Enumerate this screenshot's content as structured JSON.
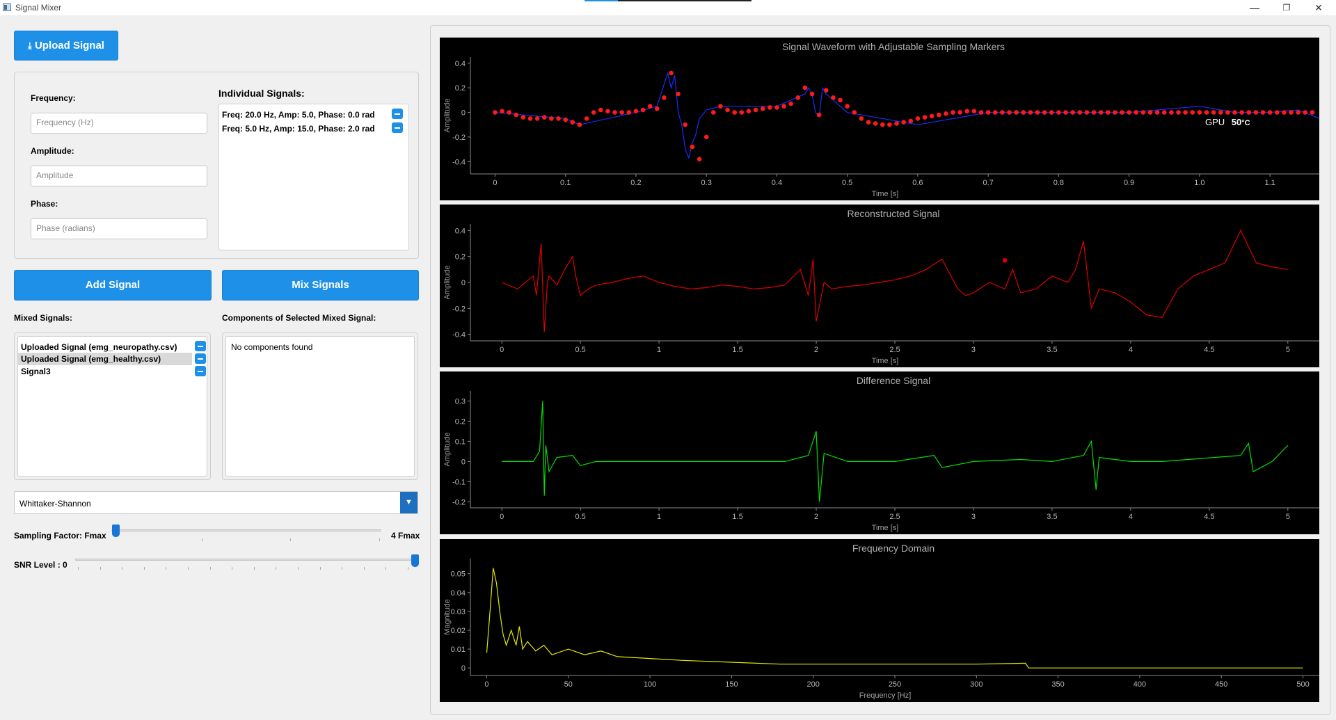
{
  "window": {
    "title": "Signal Mixer",
    "icons": [
      "minimize-icon",
      "restore-icon",
      "close-icon"
    ],
    "accent": "#1e90e8"
  },
  "upload": {
    "label": "Upload Signal",
    "icon": "upload-icon"
  },
  "form": {
    "frequency_label": "Frequency:",
    "frequency_placeholder": "Frequency (Hz)",
    "amplitude_label": "Amplitude:",
    "amplitude_placeholder": "Amplitude",
    "phase_label": "Phase:",
    "phase_placeholder": "Phase (radians)"
  },
  "individual": {
    "title": "Individual Signals:",
    "items": [
      "Freq: 20.0 Hz, Amp: 5.0, Phase: 0.0 rad",
      "Freq: 5.0 Hz, Amp: 15.0, Phase: 2.0 rad"
    ]
  },
  "buttons": {
    "add": "Add Signal",
    "mix": "Mix Signals"
  },
  "mixed": {
    "title": "Mixed Signals:",
    "items": [
      "Uploaded Signal (emg_neuropathy.csv)",
      "Uploaded Signal (emg_healthy.csv)",
      "Signal3"
    ],
    "selected_index": 1
  },
  "components": {
    "title": "Components of Selected Mixed Signal:",
    "empty_text": "No components found"
  },
  "reconstruction": {
    "method": "Whittaker-Shannon"
  },
  "sampling": {
    "label": "Sampling Factor: Fmax",
    "max_label": "4 Fmax",
    "level": 0
  },
  "snr": {
    "label": "SNR Level : 0",
    "level": 1
  },
  "gpu": {
    "label": "GPU",
    "value": "50",
    "unit": "°C"
  },
  "chart_data": [
    {
      "type": "scatter",
      "title": "Signal Waveform with Adjustable Sampling Markers",
      "xlabel": "Time [s]",
      "ylabel": "Amplitude",
      "xlim": [
        -0.035,
        1.17
      ],
      "ylim": [
        -0.5,
        0.45
      ],
      "xticks": [
        0,
        0.1,
        0.2,
        0.3,
        0.4,
        0.5,
        0.6,
        0.7,
        0.8,
        0.9,
        1.0,
        1.1
      ],
      "yticks": [
        -0.4,
        -0.2,
        0,
        0.2,
        0.4
      ],
      "xtick_labels": [
        "0",
        "0.1",
        "0.2",
        "0.3",
        "0.4",
        "0.5",
        "0.6",
        "0.7",
        "0.8",
        "0.9",
        "1.0",
        "1.1"
      ],
      "ytick_labels": [
        "-0.4",
        "-0.2",
        "0",
        "0.2",
        "0.4"
      ],
      "series": [
        {
          "kind": "line",
          "color": "#1a2cff",
          "x": [
            0,
            0.1,
            0.12,
            0.2,
            0.23,
            0.245,
            0.25,
            0.255,
            0.26,
            0.265,
            0.27,
            0.275,
            0.28,
            0.285,
            0.29,
            0.3,
            0.32,
            0.4,
            0.44,
            0.445,
            0.45,
            0.455,
            0.46,
            0.465,
            0.47,
            0.48,
            0.5,
            0.6,
            0.7,
            0.8,
            0.9,
            1.0,
            1.05,
            1.1,
            1.14,
            1.17
          ],
          "y": [
            0.0,
            -0.05,
            -0.1,
            0.0,
            0.05,
            0.32,
            0.2,
            0.3,
            0.0,
            -0.1,
            -0.3,
            -0.37,
            -0.25,
            -0.18,
            -0.05,
            0.02,
            0.05,
            0.05,
            0.15,
            0.2,
            0.15,
            0.0,
            -0.03,
            0.2,
            0.15,
            0.1,
            0.0,
            -0.1,
            0.0,
            0.0,
            0.0,
            0.05,
            0.0,
            0.0,
            0.02,
            -0.05
          ]
        },
        {
          "kind": "markers",
          "color": "#ff1a1a",
          "x": [
            0,
            0.01,
            0.02,
            0.03,
            0.04,
            0.05,
            0.06,
            0.07,
            0.08,
            0.09,
            0.1,
            0.11,
            0.12,
            0.13,
            0.14,
            0.15,
            0.16,
            0.17,
            0.18,
            0.19,
            0.2,
            0.21,
            0.22,
            0.23,
            0.24,
            0.25,
            0.26,
            0.27,
            0.28,
            0.29,
            0.3,
            0.31,
            0.32,
            0.33,
            0.34,
            0.35,
            0.36,
            0.37,
            0.38,
            0.39,
            0.4,
            0.41,
            0.42,
            0.43,
            0.44,
            0.45,
            0.46,
            0.47,
            0.48,
            0.49,
            0.5,
            0.51,
            0.52,
            0.53,
            0.54,
            0.55,
            0.56,
            0.57,
            0.58,
            0.59,
            0.6,
            0.61,
            0.62,
            0.63,
            0.64,
            0.65,
            0.66,
            0.67,
            0.68,
            0.69,
            0.7,
            0.71,
            0.72,
            0.73,
            0.74,
            0.75,
            0.76,
            0.77,
            0.78,
            0.79,
            0.8,
            0.81,
            0.82,
            0.83,
            0.84,
            0.85,
            0.86,
            0.87,
            0.88,
            0.89,
            0.9,
            0.91,
            0.92,
            0.93,
            0.94,
            0.95,
            0.96,
            0.97,
            0.98,
            0.99,
            1.0,
            1.01,
            1.02,
            1.03,
            1.04,
            1.05,
            1.06,
            1.07,
            1.08,
            1.09,
            1.1,
            1.11,
            1.12,
            1.13,
            1.14,
            1.15,
            1.16
          ],
          "y": [
            0.0,
            0.01,
            0.0,
            -0.02,
            -0.04,
            -0.05,
            -0.05,
            -0.04,
            -0.05,
            -0.05,
            -0.06,
            -0.08,
            -0.1,
            -0.05,
            0.0,
            0.02,
            0.01,
            0.0,
            0.0,
            0.0,
            0.01,
            0.02,
            0.05,
            0.03,
            0.12,
            0.32,
            0.15,
            -0.1,
            -0.28,
            -0.38,
            -0.2,
            0.0,
            0.05,
            0.02,
            0.0,
            0.0,
            0.01,
            0.02,
            0.03,
            0.04,
            0.04,
            0.05,
            0.07,
            0.12,
            0.2,
            0.15,
            -0.02,
            0.18,
            0.12,
            0.1,
            0.05,
            0.0,
            -0.05,
            -0.08,
            -0.09,
            -0.1,
            -0.1,
            -0.09,
            -0.08,
            -0.07,
            -0.05,
            -0.04,
            -0.03,
            -0.02,
            -0.01,
            0.0,
            0.0,
            0.01,
            0.01,
            0.0,
            0.0,
            0.0,
            0.0,
            0.0,
            0.0,
            0.0,
            0.0,
            0.0,
            0.0,
            0.0,
            0.0,
            0.0,
            0.0,
            0.0,
            0.0,
            0.0,
            0.0,
            0.0,
            0.0,
            0.0,
            0.0,
            0.0,
            0.0,
            0.0,
            0.0,
            0.0,
            0.0,
            0.0,
            0.0,
            0.0,
            0.0,
            0.0,
            0.0,
            0.0,
            0.0,
            0.0,
            0.0,
            0.0,
            0.0,
            0.0,
            0.0,
            0.0,
            0.0,
            0.0,
            0.0,
            0.0,
            0.0
          ]
        }
      ]
    },
    {
      "type": "line",
      "title": "Reconstructed Signal",
      "xlabel": "Time [s]",
      "ylabel": "Amplitude",
      "xlim": [
        -0.2,
        5.2
      ],
      "ylim": [
        -0.45,
        0.45
      ],
      "xticks": [
        0,
        0.5,
        1,
        1.5,
        2,
        2.5,
        3,
        3.5,
        4,
        4.5,
        5
      ],
      "yticks": [
        -0.4,
        -0.2,
        0,
        0.2,
        0.4
      ],
      "xtick_labels": [
        "0",
        "0.5",
        "1",
        "1.5",
        "2",
        "2.5",
        "3",
        "3.5",
        "4",
        "4.5",
        "5"
      ],
      "ytick_labels": [
        "-0.4",
        "-0.2",
        "0",
        "0.2",
        "0.4"
      ],
      "series": [
        {
          "color": "#e00000",
          "x": [
            0,
            0.1,
            0.2,
            0.22,
            0.25,
            0.27,
            0.29,
            0.3,
            0.35,
            0.4,
            0.45,
            0.47,
            0.5,
            0.55,
            0.6,
            0.7,
            0.8,
            0.9,
            1.0,
            1.1,
            1.2,
            1.3,
            1.4,
            1.5,
            1.6,
            1.7,
            1.8,
            1.9,
            1.95,
            1.98,
            2.0,
            2.05,
            2.1,
            2.2,
            2.3,
            2.4,
            2.5,
            2.6,
            2.7,
            2.8,
            2.9,
            2.95,
            3.0,
            3.1,
            3.2,
            3.25,
            3.3,
            3.4,
            3.5,
            3.6,
            3.65,
            3.7,
            3.75,
            3.8,
            3.9,
            4.0,
            4.1,
            4.2,
            4.3,
            4.4,
            4.5,
            4.6,
            4.7,
            4.8,
            4.9,
            5.0
          ],
          "y": [
            0.0,
            -0.05,
            0.05,
            -0.1,
            0.3,
            -0.38,
            0.0,
            0.05,
            -0.02,
            0.1,
            0.2,
            0.05,
            -0.1,
            -0.05,
            -0.02,
            0.0,
            0.03,
            0.05,
            0.0,
            -0.03,
            -0.05,
            -0.04,
            -0.02,
            -0.03,
            -0.05,
            -0.04,
            -0.02,
            0.1,
            -0.1,
            0.18,
            -0.3,
            0.0,
            -0.05,
            -0.03,
            -0.02,
            0.0,
            0.02,
            0.05,
            0.1,
            0.18,
            -0.05,
            -0.1,
            -0.08,
            0.0,
            -0.05,
            0.1,
            -0.08,
            -0.05,
            0.05,
            0.0,
            0.1,
            0.32,
            -0.2,
            -0.05,
            -0.08,
            -0.15,
            -0.25,
            -0.27,
            -0.05,
            0.05,
            0.1,
            0.15,
            0.4,
            0.15,
            0.12,
            0.1
          ]
        },
        {
          "kind": "markers",
          "color": "#e00000",
          "x": [
            3.2
          ],
          "y": [
            0.17
          ]
        }
      ]
    },
    {
      "type": "line",
      "title": "Difference Signal",
      "xlabel": "Time [s]",
      "ylabel": "Amplitude",
      "xlim": [
        -0.2,
        5.2
      ],
      "ylim": [
        -0.23,
        0.35
      ],
      "xticks": [
        0,
        0.5,
        1,
        1.5,
        2,
        2.5,
        3,
        3.5,
        4,
        4.5,
        5
      ],
      "yticks": [
        -0.2,
        -0.1,
        0,
        0.1,
        0.2,
        0.3
      ],
      "xtick_labels": [
        "0",
        "0.5",
        "1",
        "1.5",
        "2",
        "2.5",
        "3",
        "3.5",
        "4",
        "4.5",
        "5"
      ],
      "ytick_labels": [
        "-0.2",
        "-0.1",
        "0",
        "0.1",
        "0.2",
        "0.3"
      ],
      "series": [
        {
          "color": "#00e000",
          "x": [
            0,
            0.2,
            0.24,
            0.26,
            0.27,
            0.28,
            0.3,
            0.35,
            0.45,
            0.5,
            0.6,
            1.0,
            1.2,
            1.5,
            1.8,
            1.95,
            2.0,
            2.02,
            2.05,
            2.2,
            2.5,
            2.75,
            2.8,
            3.0,
            3.3,
            3.5,
            3.7,
            3.75,
            3.78,
            3.8,
            4.0,
            4.2,
            4.7,
            4.75,
            4.78,
            4.9,
            5.0
          ],
          "y": [
            0.0,
            0.0,
            0.05,
            0.3,
            -0.17,
            0.08,
            -0.05,
            0.02,
            0.03,
            -0.02,
            0.0,
            0.0,
            0.0,
            0.0,
            0.0,
            0.03,
            0.15,
            -0.2,
            0.04,
            0.0,
            0.0,
            0.03,
            -0.03,
            0.0,
            0.01,
            0.0,
            0.03,
            0.1,
            -0.14,
            0.02,
            0.0,
            0.0,
            0.03,
            0.09,
            -0.05,
            0.0,
            0.08
          ]
        }
      ]
    },
    {
      "type": "line",
      "title": "Frequency Domain",
      "xlabel": "Frequency [Hz]",
      "ylabel": "Magnitude",
      "xlim": [
        -10,
        510
      ],
      "ylim": [
        -0.004,
        0.058
      ],
      "xticks": [
        0,
        50,
        100,
        150,
        200,
        250,
        300,
        350,
        400,
        450,
        500
      ],
      "yticks": [
        0,
        0.01,
        0.02,
        0.03,
        0.04,
        0.05
      ],
      "xtick_labels": [
        "0",
        "50",
        "100",
        "150",
        "200",
        "250",
        "300",
        "350",
        "400",
        "450",
        "500"
      ],
      "ytick_labels": [
        "0",
        "0.01",
        "0.02",
        "0.03",
        "0.04",
        "0.05"
      ],
      "series": [
        {
          "color": "#e8e800",
          "x": [
            0,
            2,
            4,
            6,
            8,
            10,
            12,
            15,
            18,
            20,
            22,
            25,
            30,
            35,
            40,
            50,
            60,
            70,
            80,
            100,
            120,
            150,
            180,
            200,
            250,
            300,
            330,
            332,
            340,
            400,
            500
          ],
          "y": [
            0.008,
            0.03,
            0.053,
            0.045,
            0.03,
            0.018,
            0.012,
            0.02,
            0.012,
            0.022,
            0.01,
            0.014,
            0.009,
            0.012,
            0.007,
            0.01,
            0.007,
            0.009,
            0.006,
            0.005,
            0.004,
            0.003,
            0.002,
            0.002,
            0.002,
            0.002,
            0.0025,
            0.0,
            0.0,
            0.0,
            0.0
          ]
        }
      ]
    }
  ]
}
